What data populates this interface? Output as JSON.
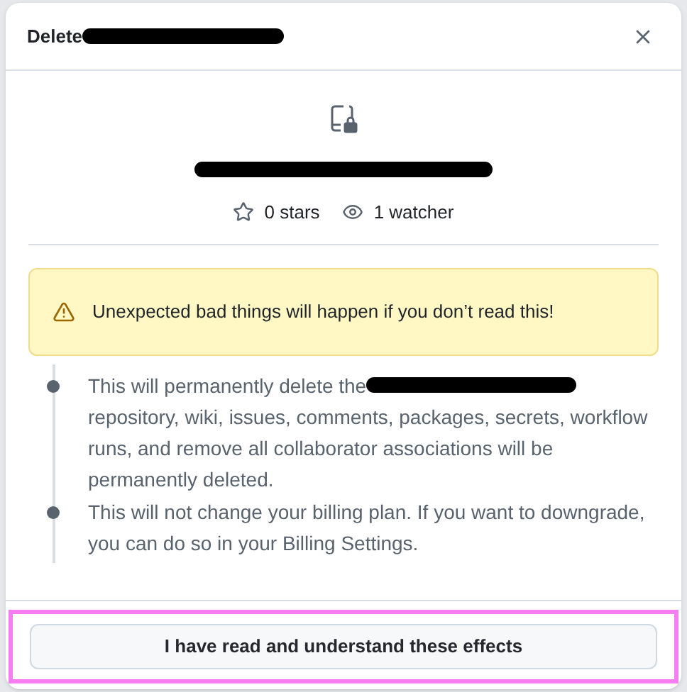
{
  "dialog": {
    "title": "Delete",
    "title_redacted": true,
    "repo_name_redacted": true,
    "stats": [
      {
        "kind": "star",
        "text": "0 stars"
      },
      {
        "kind": "eye",
        "text": "1 watcher"
      }
    ],
    "warning": "Unexpected bad things will happen if you don’t read this!",
    "effects": [
      {
        "lead": "This will permanently delete the",
        "redacted": true,
        "rest": "repository, wiki, issues, comments, packages, secrets, workflow runs, and remove all collaborator associations will be permanently deleted."
      },
      {
        "lead": "This will not change your billing plan. If you want to downgrade, you can do so in your Billing Settings.",
        "redacted": false
      }
    ],
    "button": "I have read and understand these effects",
    "button_highlighted": true
  }
}
